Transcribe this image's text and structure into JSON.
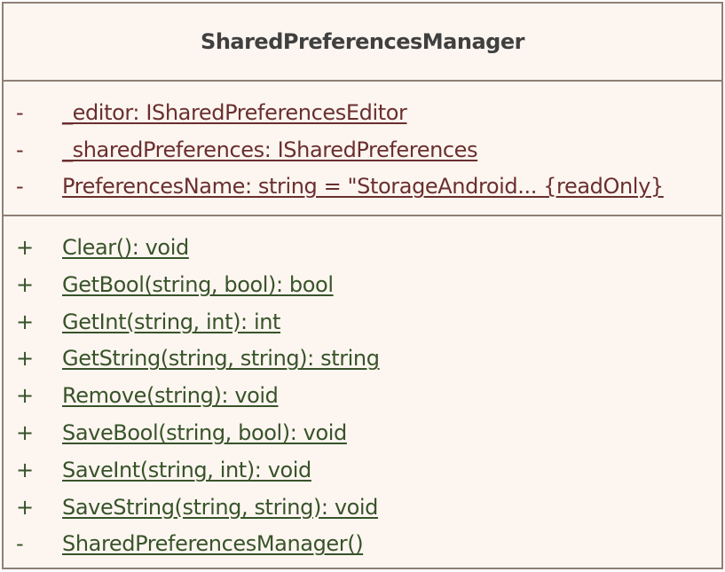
{
  "diagram": {
    "class_name": "SharedPreferencesManager",
    "colors": {
      "fill": "#fdf6f0",
      "border": "#8f7f75",
      "attribute_text": "#6a2f2f",
      "operation_text": "#38532a"
    },
    "attributes": [
      {
        "visibility": "-",
        "text": "_editor: ISharedPreferencesEditor"
      },
      {
        "visibility": "-",
        "text": "_sharedPreferences: ISharedPreferences"
      },
      {
        "visibility": "-",
        "text": "PreferencesName: string = \"StorageAndroid... {readOnly}"
      }
    ],
    "operations": [
      {
        "visibility": "+",
        "text": "Clear(): void"
      },
      {
        "visibility": "+",
        "text": "GetBool(string, bool): bool"
      },
      {
        "visibility": "+",
        "text": "GetInt(string, int): int"
      },
      {
        "visibility": "+",
        "text": "GetString(string, string): string"
      },
      {
        "visibility": "+",
        "text": "Remove(string): void"
      },
      {
        "visibility": "+",
        "text": "SaveBool(string, bool): void"
      },
      {
        "visibility": "+",
        "text": "SaveInt(string, int): void"
      },
      {
        "visibility": "+",
        "text": "SaveString(string, string): void"
      },
      {
        "visibility": "-",
        "text": "SharedPreferencesManager()"
      }
    ]
  }
}
